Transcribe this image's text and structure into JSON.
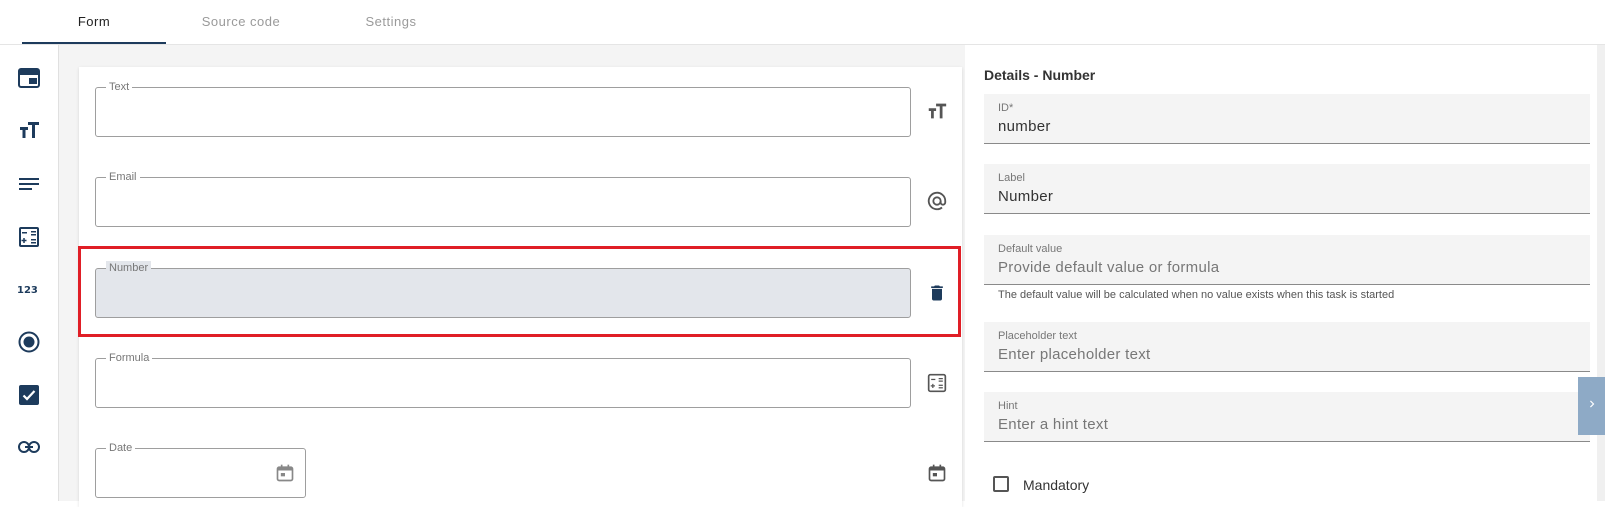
{
  "tabs": [
    {
      "label": "Form"
    },
    {
      "label": "Source code"
    },
    {
      "label": "Settings"
    }
  ],
  "sidebar": {
    "icons": [
      "layout-icon",
      "text-size-icon",
      "paragraph-icon",
      "formula-calculator-icon",
      "number-123-icon",
      "radio-button-icon",
      "checkbox-icon",
      "link-icon"
    ]
  },
  "form": {
    "fields": [
      {
        "legend": "Text",
        "icon": "text-size-icon"
      },
      {
        "legend": "Email",
        "icon": "at-sign-icon"
      },
      {
        "legend": "Number",
        "icon": "delete-icon"
      },
      {
        "legend": "Formula",
        "icon": "formula-calculator-icon"
      },
      {
        "legend": "Date",
        "icon": "calendar-icon"
      }
    ]
  },
  "details": {
    "title": "Details - Number",
    "id": {
      "label": "ID*",
      "value": "number"
    },
    "label": {
      "label": "Label",
      "value": "Number"
    },
    "default_value": {
      "label": "Default value",
      "placeholder": "Provide default value or formula",
      "hint": "The default value will be calculated when no value exists when this task is started"
    },
    "placeholder_text": {
      "label": "Placeholder text",
      "placeholder": "Enter placeholder text"
    },
    "hint": {
      "label": "Hint",
      "placeholder": "Enter a hint text"
    },
    "mandatory": {
      "label": "Mandatory"
    }
  },
  "colors": {
    "accent": "#1d3b5c",
    "highlight": "#e01e26",
    "selected_field": "#e3e6eb",
    "collapse_button": "#8eaac6"
  }
}
